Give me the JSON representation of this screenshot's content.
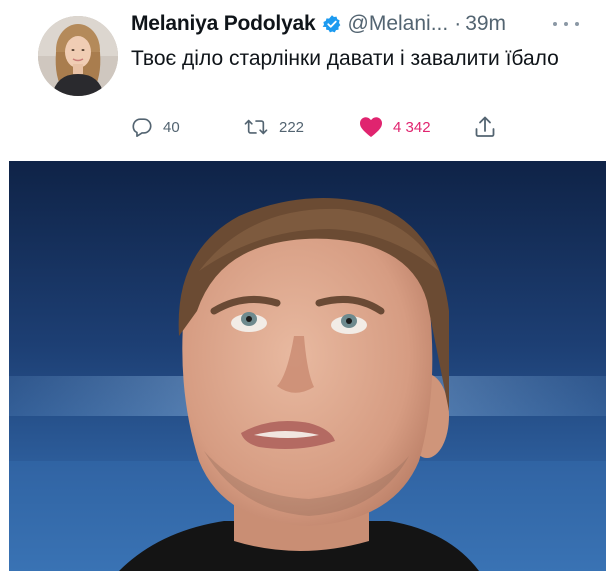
{
  "tweet": {
    "author_name": "Melaniya Podolyak",
    "handle": "@Melani...",
    "separator": "·",
    "time": "39m",
    "text": "Твоє діло старлінки давати і завалити їбало",
    "verified": true,
    "icons": {
      "verified": "verified-badge-icon",
      "more": "more-horizontal-icon",
      "reply": "reply-icon",
      "retweet": "retweet-icon",
      "like": "heart-icon",
      "share": "share-icon"
    },
    "counts": {
      "replies": "40",
      "retweets": "222",
      "likes": "4 342"
    },
    "colors": {
      "verified": "#1d9bf0",
      "like": "#e0246f",
      "muted": "#536471",
      "text": "#0f1419"
    }
  }
}
